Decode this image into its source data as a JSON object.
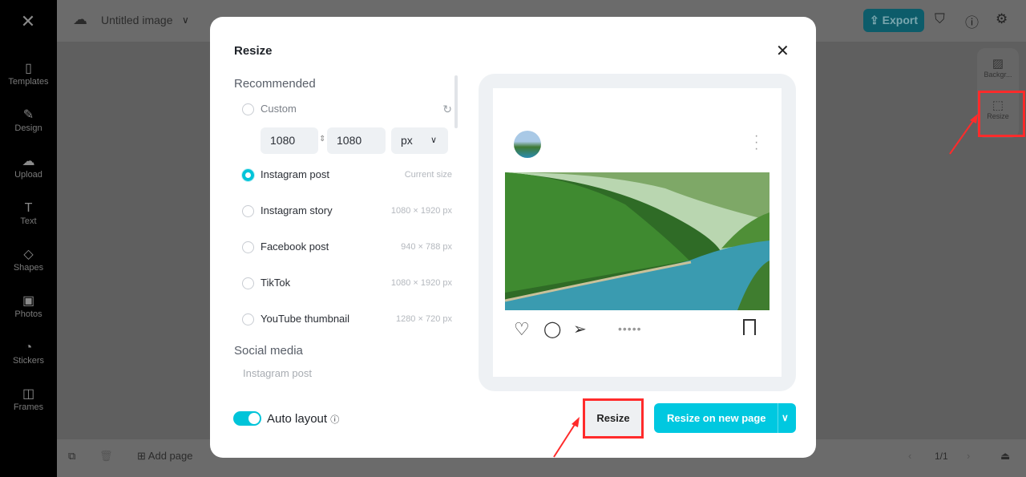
{
  "app": {
    "title": "Untitled image",
    "export_label": "Export"
  },
  "sidebar": {
    "items": [
      {
        "label": "Templates",
        "icon": "templates-icon"
      },
      {
        "label": "Design",
        "icon": "design-icon"
      },
      {
        "label": "Upload",
        "icon": "upload-icon"
      },
      {
        "label": "Text",
        "icon": "text-icon"
      },
      {
        "label": "Shapes",
        "icon": "shapes-icon"
      },
      {
        "label": "Photos",
        "icon": "photos-icon"
      },
      {
        "label": "Stickers",
        "icon": "stickers-icon"
      },
      {
        "label": "Frames",
        "icon": "frames-icon"
      }
    ]
  },
  "right_panel": {
    "items": [
      {
        "label": "Backgr..."
      },
      {
        "label": "Resize"
      }
    ]
  },
  "bottom": {
    "add_page": "Add page",
    "pages": "1/1"
  },
  "dialog": {
    "title": "Resize",
    "recommended": "Recommended",
    "custom": {
      "label": "Custom",
      "width": "1080",
      "height": "1080",
      "unit": "px"
    },
    "options": [
      {
        "label": "Instagram post",
        "size": "Current size",
        "selected": true
      },
      {
        "label": "Instagram story",
        "size": "1080 × 1920 px"
      },
      {
        "label": "Facebook post",
        "size": "940 × 788 px"
      },
      {
        "label": "TikTok",
        "size": "1080 × 1920 px"
      },
      {
        "label": "YouTube thumbnail",
        "size": "1280 × 720 px"
      }
    ],
    "social_media": "Social media",
    "social_first": "Instagram post",
    "auto_layout": "Auto layout",
    "auto_layout_on": true,
    "resize_button": "Resize",
    "resize_new_button": "Resize on new page"
  },
  "colors": {
    "accent": "#00c4d9",
    "annotation": "#ff2b2b"
  }
}
